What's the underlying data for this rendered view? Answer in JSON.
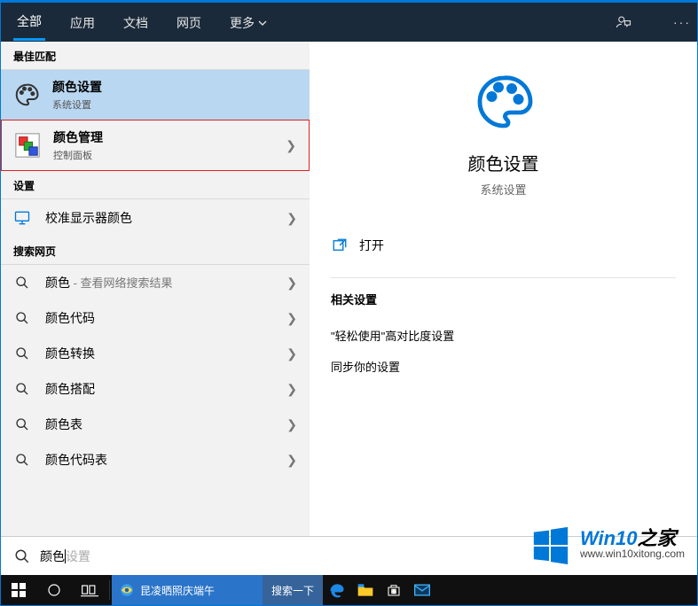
{
  "tabs": {
    "all": "全部",
    "app": "应用",
    "doc": "文档",
    "web": "网页",
    "more": "更多"
  },
  "sections": {
    "best_match": "最佳匹配",
    "settings": "设置",
    "search_web": "搜索网页"
  },
  "best": [
    {
      "title": "颜色设置",
      "sub": "系统设置"
    },
    {
      "title": "颜色管理",
      "sub": "控制面板"
    }
  ],
  "settings_items": [
    {
      "label": "校准显示器颜色"
    }
  ],
  "web_items": [
    {
      "label": "颜色",
      "suffix": " - 查看网络搜索结果"
    },
    {
      "label": "颜色代码"
    },
    {
      "label": "颜色转换"
    },
    {
      "label": "颜色搭配"
    },
    {
      "label": "颜色表"
    },
    {
      "label": "颜色代码表"
    }
  ],
  "preview": {
    "title": "颜色设置",
    "sub": "系统设置",
    "open": "打开",
    "related_title": "相关设置",
    "related": [
      "\"轻松使用\"高对比度设置",
      "同步你的设置"
    ]
  },
  "search": {
    "typed": "颜色",
    "ghost": "设置"
  },
  "taskbar": {
    "ie_title": "昆凌晒照庆端午",
    "search_btn": "搜索一下"
  },
  "watermark": {
    "brand1": "Win10",
    "brand2": "之家",
    "url": "www.win10xitong.com"
  }
}
